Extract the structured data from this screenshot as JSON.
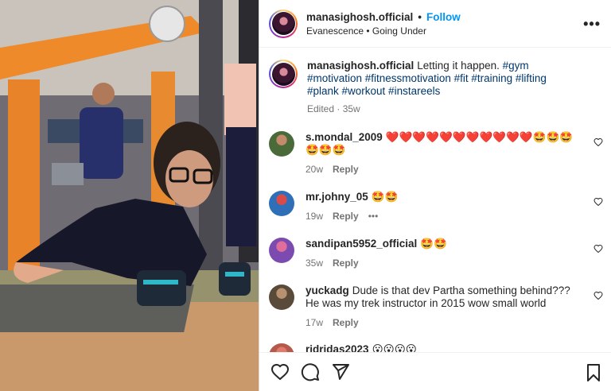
{
  "header": {
    "username": "manasighosh.official",
    "separator": "•",
    "follow_label": "Follow",
    "audio": "Evanescence • Going Under",
    "more_icon": "more-horizontal-icon"
  },
  "caption": {
    "username": "manasighosh.official",
    "text": "Letting it happen.",
    "hashtags": "#gym #motivation #fitnessmotivation #fit #training #lifting #plank #workout #instareels",
    "meta": "Edited · 35w"
  },
  "comments": [
    {
      "username": "s.mondal_2009",
      "text": "❤️❤️❤️❤️❤️❤️❤️❤️❤️❤️❤️🤩🤩🤩🤩🤩🤩",
      "age": "20w",
      "reply_label": "Reply"
    },
    {
      "username": "mr.johny_05",
      "text": "🤩🤩",
      "age": "19w",
      "reply_label": "Reply",
      "more": "•••"
    },
    {
      "username": "sandipan5952_official",
      "text": "🤩🤩",
      "age": "35w",
      "reply_label": "Reply"
    },
    {
      "username": "yuckadg",
      "text": "Dude is that dev Partha something behind??? He was my trek instructor in 2015 wow small world",
      "age": "17w",
      "reply_label": "Reply"
    },
    {
      "username": "ridridas2023",
      "text": "😮😮😮😮"
    }
  ],
  "actions": {
    "like_icon": "heart-icon",
    "comment_icon": "comment-icon",
    "share_icon": "share-icon",
    "save_icon": "bookmark-icon"
  },
  "colors": {
    "follow": "#0095f6",
    "hashtag": "#00376b",
    "meta": "#737373"
  }
}
